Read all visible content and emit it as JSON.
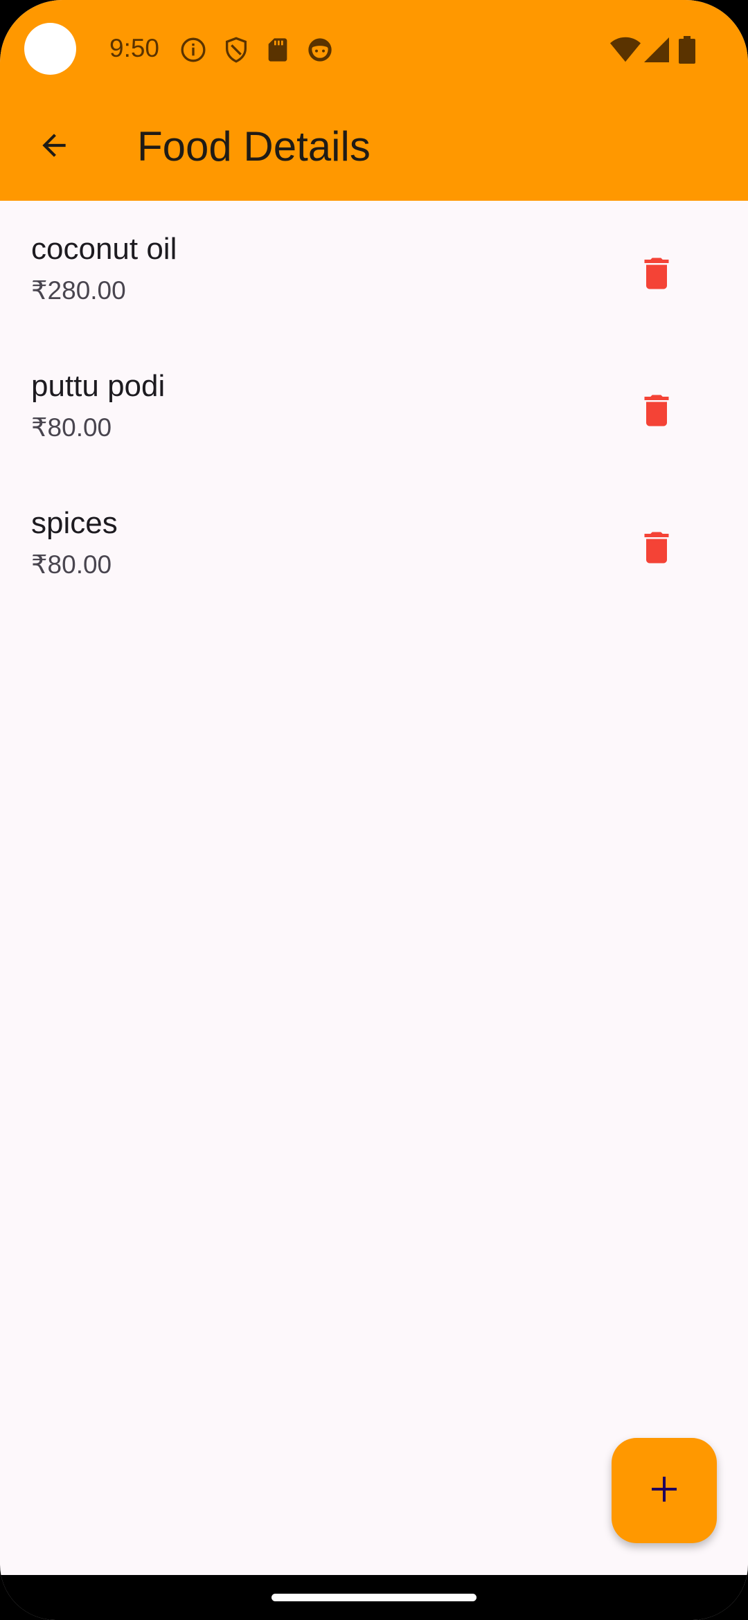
{
  "status_bar": {
    "time": "9:50",
    "icons": [
      "info-icon",
      "shield-icon",
      "sd-card-icon",
      "face-icon",
      "wifi-icon",
      "signal-icon",
      "battery-icon"
    ]
  },
  "app_bar": {
    "title": "Food Details",
    "back_icon": "arrow-back-icon",
    "background_color": "#ff9800"
  },
  "items": [
    {
      "name": "coconut oil",
      "price": "₹280.00"
    },
    {
      "name": "puttu podi",
      "price": "₹80.00"
    },
    {
      "name": "spices",
      "price": "₹80.00"
    }
  ],
  "delete_icon": "trash-icon",
  "delete_color": "#f44336",
  "fab": {
    "icon": "plus-icon",
    "color": "#ff9800"
  }
}
